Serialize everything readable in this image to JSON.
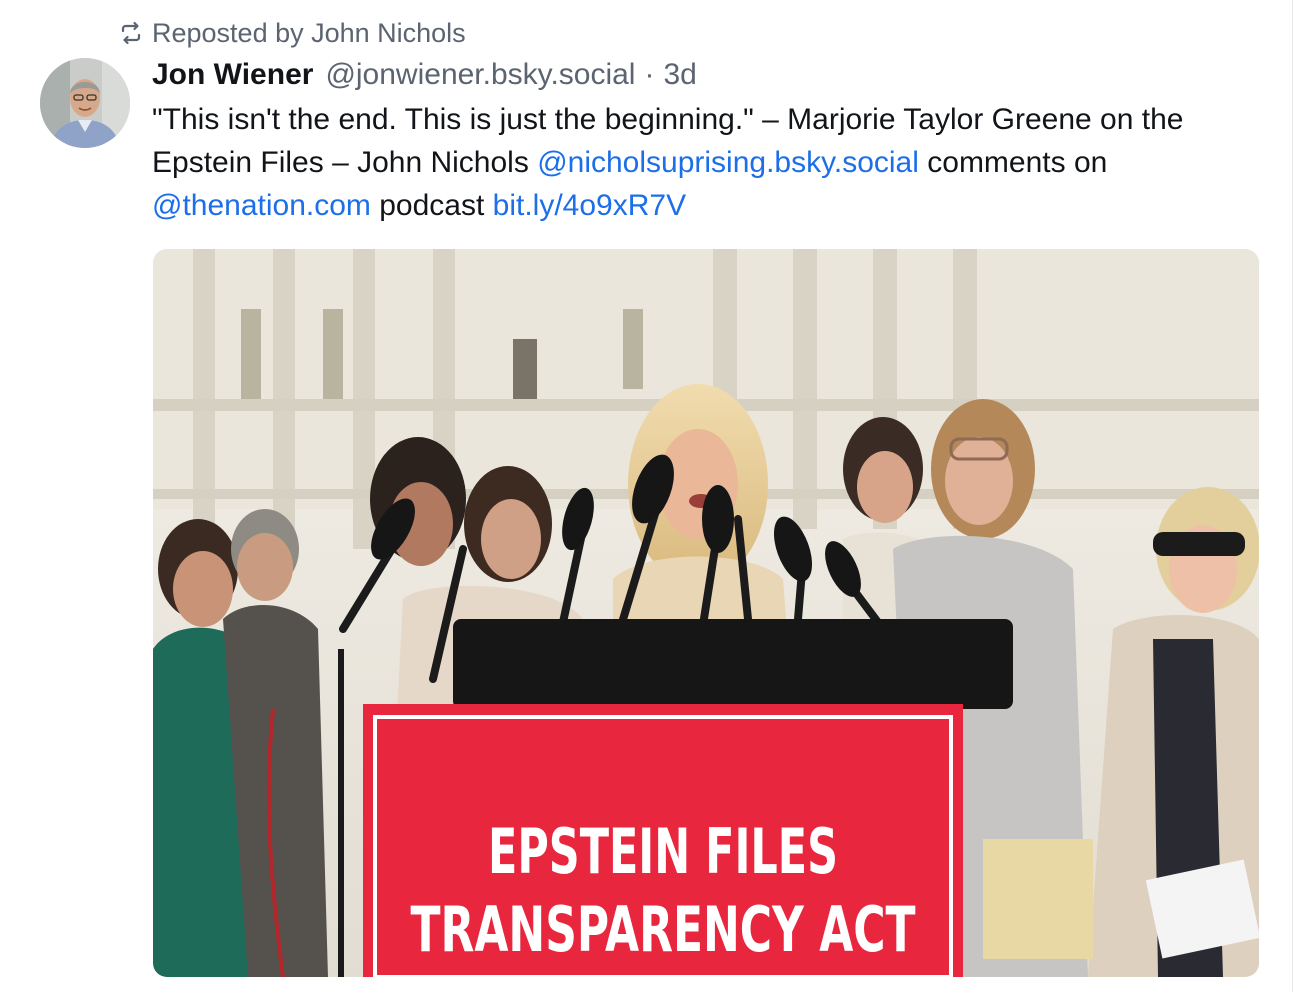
{
  "repost": {
    "label": "Reposted by John Nichols",
    "icon": "repost-icon"
  },
  "post": {
    "author": {
      "name": "Jon Wiener",
      "handle": "@jonwiener.bsky.social",
      "avatar_icon": "avatar-photo"
    },
    "separator": "·",
    "timestamp": "3d",
    "text": {
      "p1": "\"This isn't the end. This is just the beginning.\" – Marjorie Taylor Greene on the Epstein Files – John Nichols ",
      "link1": "@nicholsuprising.bsky.social",
      "p2": " comments on ",
      "link2": "@thenation.com",
      "p3": " podcast ",
      "link3": "bit.ly/4o9xR7V"
    },
    "image": {
      "sign_line1": "EPSTEIN FILES",
      "sign_line2": "TRANSPARENCY ACT"
    }
  },
  "colors": {
    "link": "#1c6fe8",
    "muted": "#5b6470",
    "text": "#111418",
    "sign_red": "#e8273f"
  }
}
